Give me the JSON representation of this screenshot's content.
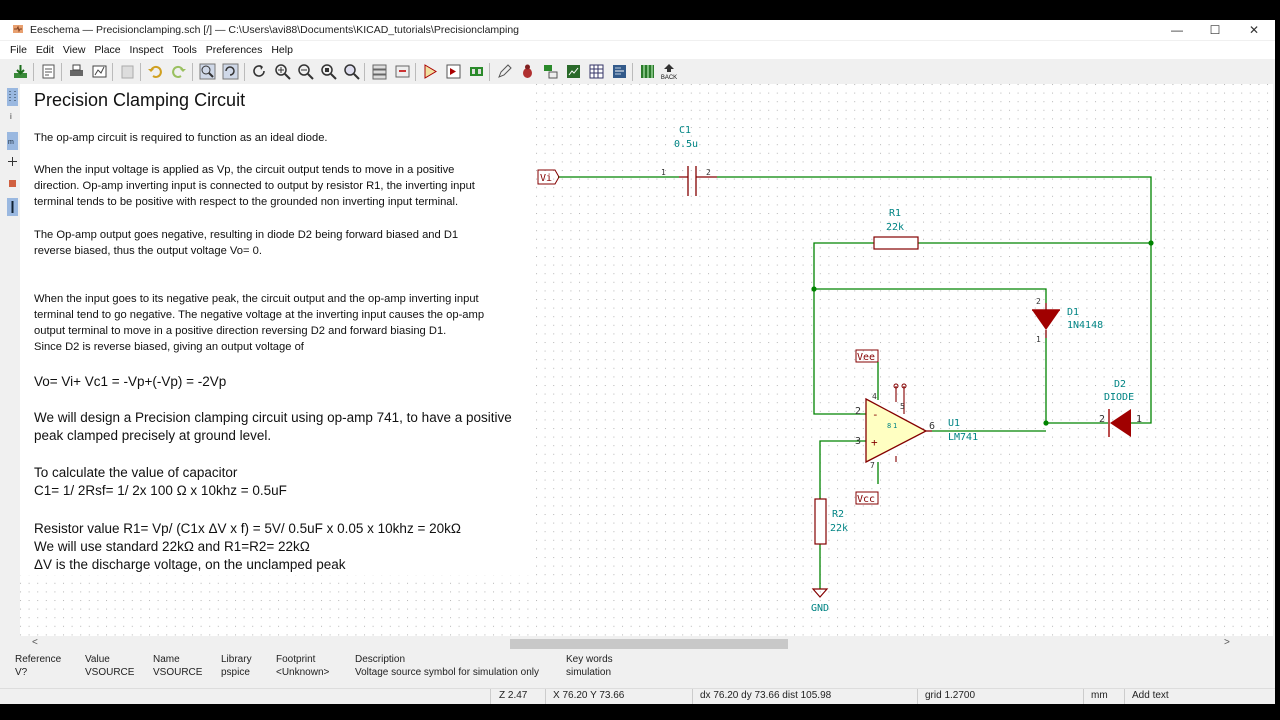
{
  "window": {
    "title": "Eeschema — Precisionclamping.sch [/] — C:\\Users\\avi88\\Documents\\KICAD_tutorials\\Precisionclamping",
    "minimize": "—",
    "maximize": "☐",
    "close": "✕"
  },
  "menu": [
    "File",
    "Edit",
    "View",
    "Place",
    "Inspect",
    "Tools",
    "Preferences",
    "Help"
  ],
  "toolbar": {
    "back_label": "BACK",
    "icons": [
      "save-icon",
      "page-settings-icon",
      "print-icon",
      "plot-icon",
      "paste-icon",
      "undo-icon",
      "redo-icon",
      "find-icon",
      "find-replace-icon",
      "refresh-icon",
      "zoom-in-icon",
      "zoom-out-icon",
      "zoom-fit-icon",
      "zoom-selection-icon",
      "hierarchy-navigator-icon",
      "leave-sheet-icon",
      "symbol-editor-icon",
      "symbol-browser-icon",
      "footprint-editor-icon",
      "annotate-icon",
      "erc-icon",
      "assign-footprints-icon",
      "bom-icon",
      "netlist-icon",
      "pcbnew-icon",
      "back-icon"
    ]
  },
  "notes": {
    "heading": "Precision Clamping Circuit",
    "p1": "The op-amp circuit is required to function as an ideal diode.",
    "p2": "When the input voltage is applied as Vp, the circuit output tends to move in a positive\ndirection. Op-amp inverting input is connected to output by resistor R1, the inverting input\nterminal tends to be positive with respect to the grounded non inverting input terminal.",
    "p3": "The Op-amp output goes negative, resulting in diode D2 being forward biased and D1\nreverse biased, thus the output voltage Vo= 0.",
    "p4": "When the input goes to its negative peak, the circuit output and the op-amp inverting input\nterminal tend to go negative. The negative voltage at the inverting input causes the op-amp\noutput terminal to move in a positive direction reversing D2 and forward biasing D1.\nSince D2 is reverse biased, giving an output voltage of",
    "eq": "Vo= Vi+ Vc1 = -Vp+(-Vp) = -2Vp",
    "p5": "We will design a Precision clamping circuit using op-amp 741, to have a positive\npeak clamped precisely at ground level.",
    "p6": "To calculate the value of capacitor\nC1= 1/ 2Rsf= 1/ 2x 100 Ω x 10khz = 0.5uF",
    "p7": "Resistor value R1= Vp/ (C1x ΔV x f)  = 5V/ 0.5uF x 0.05 x 10khz = 20kΩ\nWe will use standard 22kΩ and R1=R2= 22kΩ\nΔV is the discharge voltage, on the unclamped peak"
  },
  "schematic": {
    "label_vi": "Vi",
    "c1_ref": "C1",
    "c1_val": "0.5u",
    "c1_pin1": "1",
    "c1_pin2": "2",
    "r1_ref": "R1",
    "r1_val": "22k",
    "d1_ref": "D1",
    "d1_val": "1N4148",
    "d1_pin1": "1",
    "d1_pin2": "2",
    "d2_ref": "D2",
    "d2_val": "DIODE",
    "d2_pin1": "1",
    "d2_pin2": "2",
    "u1_ref": "U1",
    "u1_val": "LM741",
    "u1_pins": [
      "2",
      "3",
      "6",
      "4",
      "7",
      "5",
      "1",
      "8"
    ],
    "u1_minus": "-",
    "u1_plus": "+",
    "vee": "Vee",
    "vcc": "Vcc",
    "r2_ref": "R2",
    "r2_val": "22k",
    "gnd": "GND"
  },
  "message_panel": [
    {
      "label": "Reference",
      "value": "V?"
    },
    {
      "label": "Value",
      "value": "VSOURCE"
    },
    {
      "label": "Name",
      "value": "VSOURCE"
    },
    {
      "label": "Library",
      "value": "pspice"
    },
    {
      "label": "Footprint",
      "value": "<Unknown>"
    },
    {
      "label": "Description",
      "value": "Voltage source symbol for simulation only"
    },
    {
      "label": "Key words",
      "value": "simulation"
    }
  ],
  "status": {
    "zoom": "Z 2.47",
    "xy": "X 76.20  Y 73.66",
    "dxy": "dx 76.20  dy 73.66  dist 105.98",
    "grid": "grid 1.2700",
    "units": "mm",
    "mode": "Add text"
  },
  "colors": {
    "wire": "#008400",
    "symbol": "#840000",
    "symbol_fill": "#ffffc2",
    "field": "#008484",
    "diode_fill": "#a00000"
  }
}
